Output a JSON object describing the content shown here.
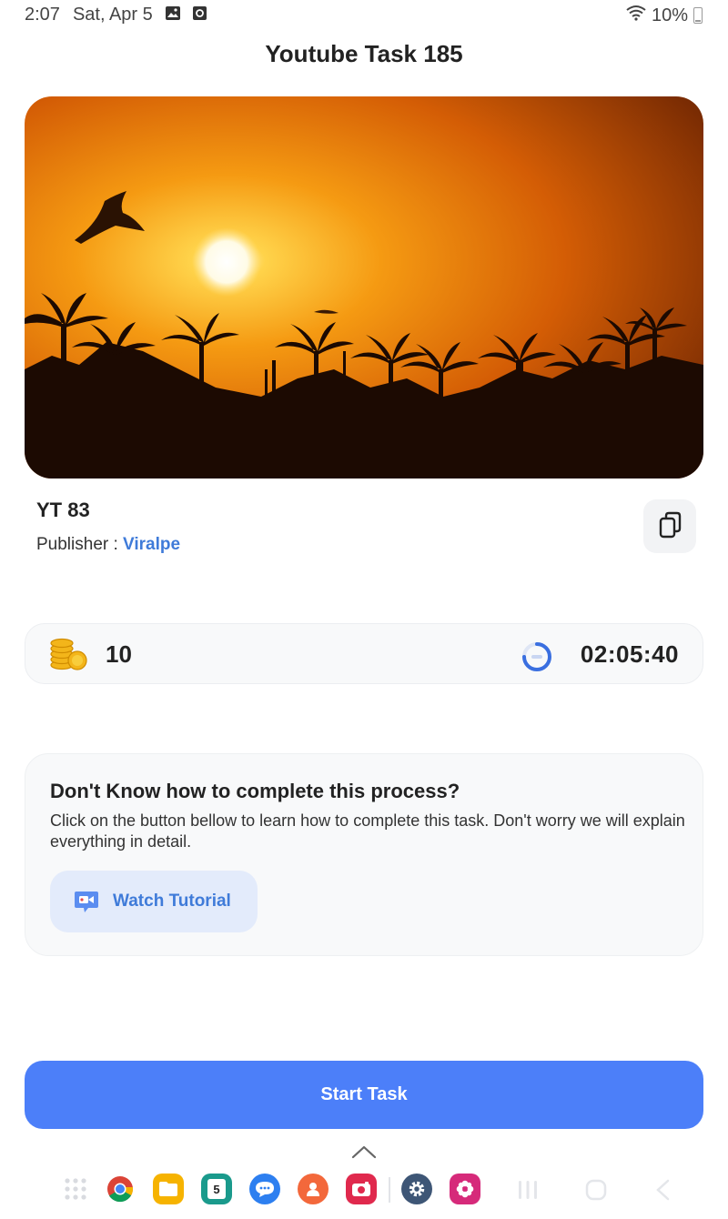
{
  "status_bar": {
    "time": "2:07",
    "date": "Sat, Apr 5",
    "battery": "10%"
  },
  "page": {
    "title": "Youtube Task 185"
  },
  "task": {
    "name": "YT 83",
    "publisher_label": "Publisher : ",
    "publisher_name": "Viralpe"
  },
  "stats": {
    "coins": "10",
    "timer": "02:05:40"
  },
  "help": {
    "title": "Don't Know how to complete this process?",
    "body": "Click on the button bellow to learn how to complete this task. Don't worry we will explain everything in detail.",
    "tutorial_label": "Watch Tutorial"
  },
  "actions": {
    "start_label": "Start Task"
  },
  "dock": {
    "apps": [
      "app-grid-icon",
      "chrome-icon",
      "files-icon",
      "calendar-icon",
      "messages-icon",
      "contacts-icon",
      "camera-icon",
      "settings-icon",
      "gallery-icon"
    ],
    "calendar_day": "5"
  },
  "colors": {
    "accent": "#4c7ff9",
    "link": "#3f7bd9",
    "tutorial_bg": "#e3ebfb"
  }
}
